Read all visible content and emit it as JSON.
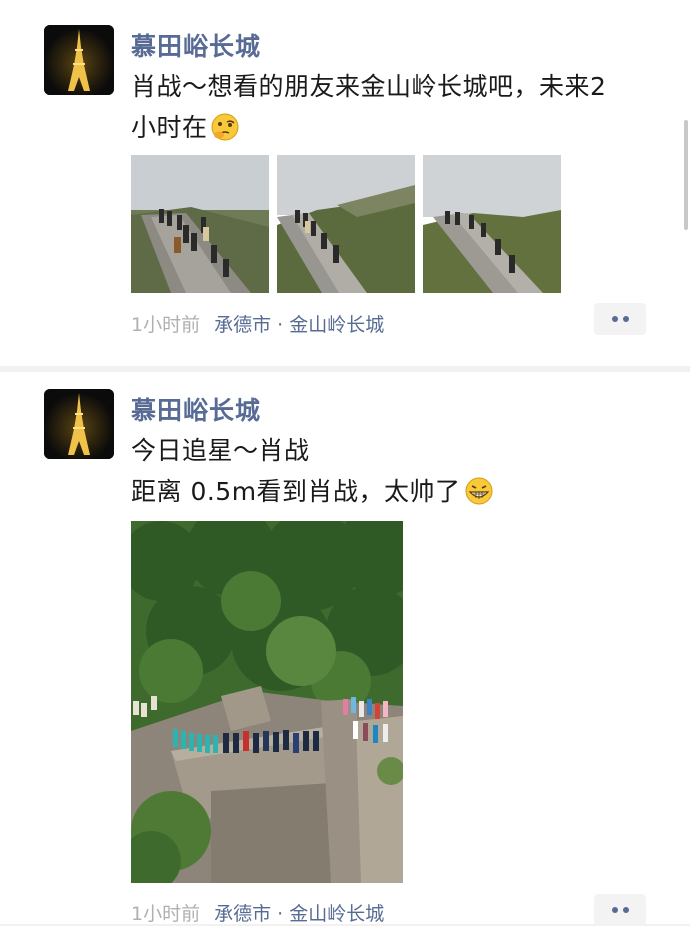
{
  "feed": {
    "posts": [
      {
        "username": "慕田峪长城",
        "text_lines": [
          "肖战～想看的朋友来金山岭长城吧，未来2",
          "小时在"
        ],
        "emoji": "thinking-face-emoji",
        "photos": [
          {
            "icon": "great-wall-stairs-photo"
          },
          {
            "icon": "great-wall-hillside-photo"
          },
          {
            "icon": "great-wall-walkway-photo"
          }
        ],
        "time": "1小时前",
        "location": "承德市 · 金山岭长城"
      },
      {
        "username": "慕田峪长城",
        "text_lines": [
          "今日追星～肖战",
          "距离 0.5m看到肖战，太帅了"
        ],
        "emoji": "grinning-face-emoji",
        "photo": {
          "icon": "crowd-on-great-wall-photo"
        },
        "time": "1小时前",
        "location": "承德市 · 金山岭长城"
      }
    ]
  },
  "avatar_icon": "eiffel-tower-night-icon",
  "more_icon": "more-dots-icon",
  "colors": {
    "link": "#576b95",
    "meta_gray": "#b0b0b0",
    "background": "#f1f1f1"
  }
}
